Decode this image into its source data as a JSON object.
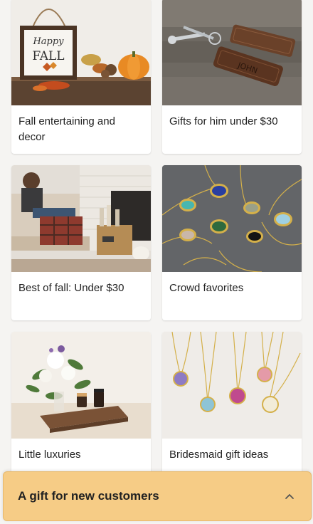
{
  "cards": [
    {
      "label": "Fall entertaining and decor",
      "image_icon": "fall-decor-image"
    },
    {
      "label": "Gifts for him under $30",
      "image_icon": "leather-keychain-image"
    },
    {
      "label": "Best of fall: Under $30",
      "image_icon": "cozy-living-room-image"
    },
    {
      "label": "Crowd favorites",
      "image_icon": "gemstone-necklaces-image"
    },
    {
      "label": "Little luxuries",
      "image_icon": "candles-flowers-image"
    },
    {
      "label": "Bridesmaid gift ideas",
      "image_icon": "initial-pendants-image"
    }
  ],
  "fall_sign": {
    "line1": "Happy",
    "line2": "FALL"
  },
  "keychain_text": "JOHN",
  "banner": {
    "title": "A gift for new customers",
    "icon": "chevron-up-icon"
  },
  "colors": {
    "banner_bg": "#f6cc86",
    "page_bg": "#f5f4f2"
  }
}
